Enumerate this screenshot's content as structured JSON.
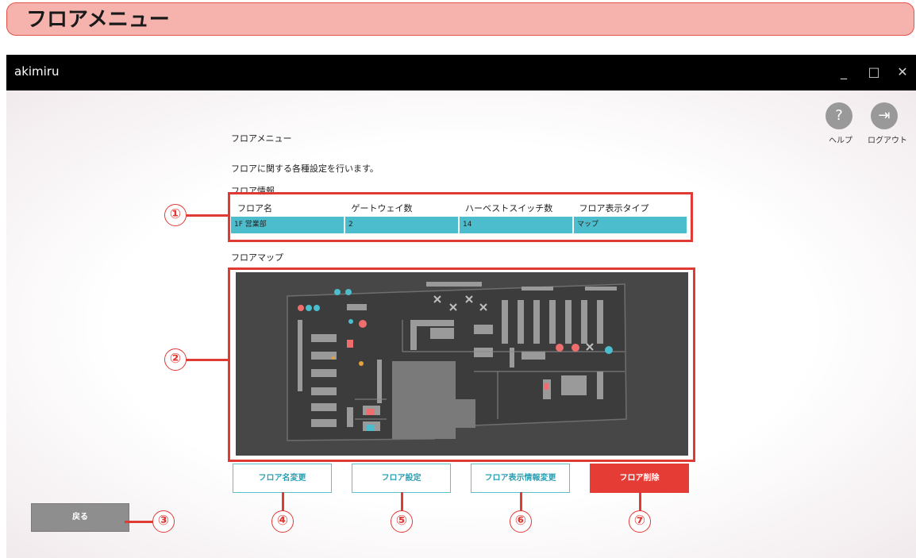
{
  "banner": {
    "title": "フロアメニュー"
  },
  "window": {
    "app_name": "akimiru",
    "minimize": "_",
    "maximize": "□",
    "close": "✕"
  },
  "header_icons": {
    "help_label": "ヘルプ",
    "logout_label": "ログアウト",
    "help_glyph": "?",
    "logout_glyph": "⇥"
  },
  "page": {
    "title": "フロアメニュー",
    "description": "フロアに関する各種設定を行います。",
    "floor_info_label": "フロア情報",
    "floor_map_label": "フロアマップ"
  },
  "floor_table": {
    "headers": [
      "フロア名",
      "ゲートウェイ数",
      "ハーベストスイッチ数",
      "フロア表示タイプ"
    ],
    "row": [
      "1F 営業部",
      "2",
      "14",
      "マップ"
    ]
  },
  "buttons": {
    "rename": "フロア名変更",
    "settings": "フロア設定",
    "display_info": "フロア表示情報変更",
    "delete": "フロア削除",
    "back": "戻る"
  },
  "callouts": [
    "①",
    "②",
    "③",
    "④",
    "⑤",
    "⑥",
    "⑦"
  ],
  "colors": {
    "accent": "#4cbdcd",
    "danger": "#e63c36",
    "callout": "#e03a35",
    "banner": "#f6b2ac"
  }
}
